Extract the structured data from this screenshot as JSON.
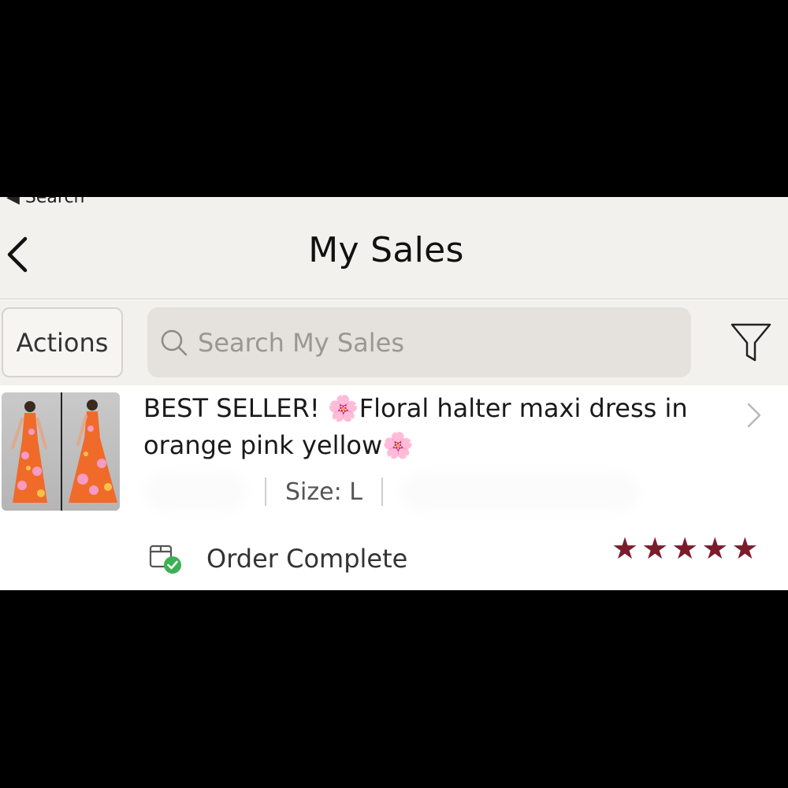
{
  "status_bar": {
    "back_label": "◀ Search"
  },
  "header": {
    "title": "My Sales"
  },
  "toolbar": {
    "actions_label": "Actions",
    "search_placeholder": "Search My Sales"
  },
  "sale_item": {
    "title": "BEST SELLER! 🌸Floral halter maxi dress in orange pink yellow🌸",
    "size": "Size: L",
    "order_status": "Order Complete",
    "rating": 5,
    "rating_max": 5
  },
  "colors": {
    "header_background": "#f2f1ee",
    "search_background": "#e5e2dd",
    "star_color": "#7a1c2c",
    "status_check_color": "#3cb054"
  },
  "icons": [
    "chevron-left-icon",
    "search-icon",
    "filter-icon",
    "chevron-right-icon",
    "package-check-icon",
    "star-icon"
  ]
}
